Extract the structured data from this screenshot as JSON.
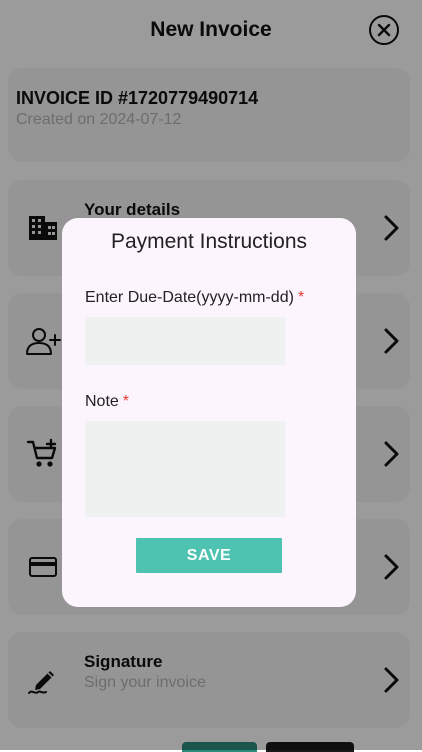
{
  "header": {
    "title": "New Invoice"
  },
  "invoice": {
    "id_label": "INVOICE ID #1720779490714",
    "created": "Created on 2024-07-12"
  },
  "rows": [
    {
      "title": "Your details",
      "subtitle": "",
      "icon": "building-icon"
    },
    {
      "title": "",
      "subtitle": "",
      "icon": "add-person-icon"
    },
    {
      "title": "",
      "subtitle": "",
      "icon": "cart-add-icon"
    },
    {
      "title": "",
      "subtitle": "",
      "icon": "credit-card-icon"
    },
    {
      "title": "Signature",
      "subtitle": "Sign your invoice",
      "icon": "pen-signature-icon"
    }
  ],
  "modal": {
    "title": "Payment Instructions",
    "due_date_label": "Enter Due-Date(yyyy-mm-dd)",
    "due_date_value": "",
    "note_label": "Note",
    "note_value": "",
    "required_mark": "*",
    "save_label": "SAVE"
  },
  "colors": {
    "accent": "#4ec3b2",
    "required": "#e53935",
    "modal_bg": "#fcf5fd",
    "card_bg": "#f1f1f1",
    "bottom_button_teal": "#2a8a7b",
    "bottom_button_dark": "#1a1a1a"
  }
}
